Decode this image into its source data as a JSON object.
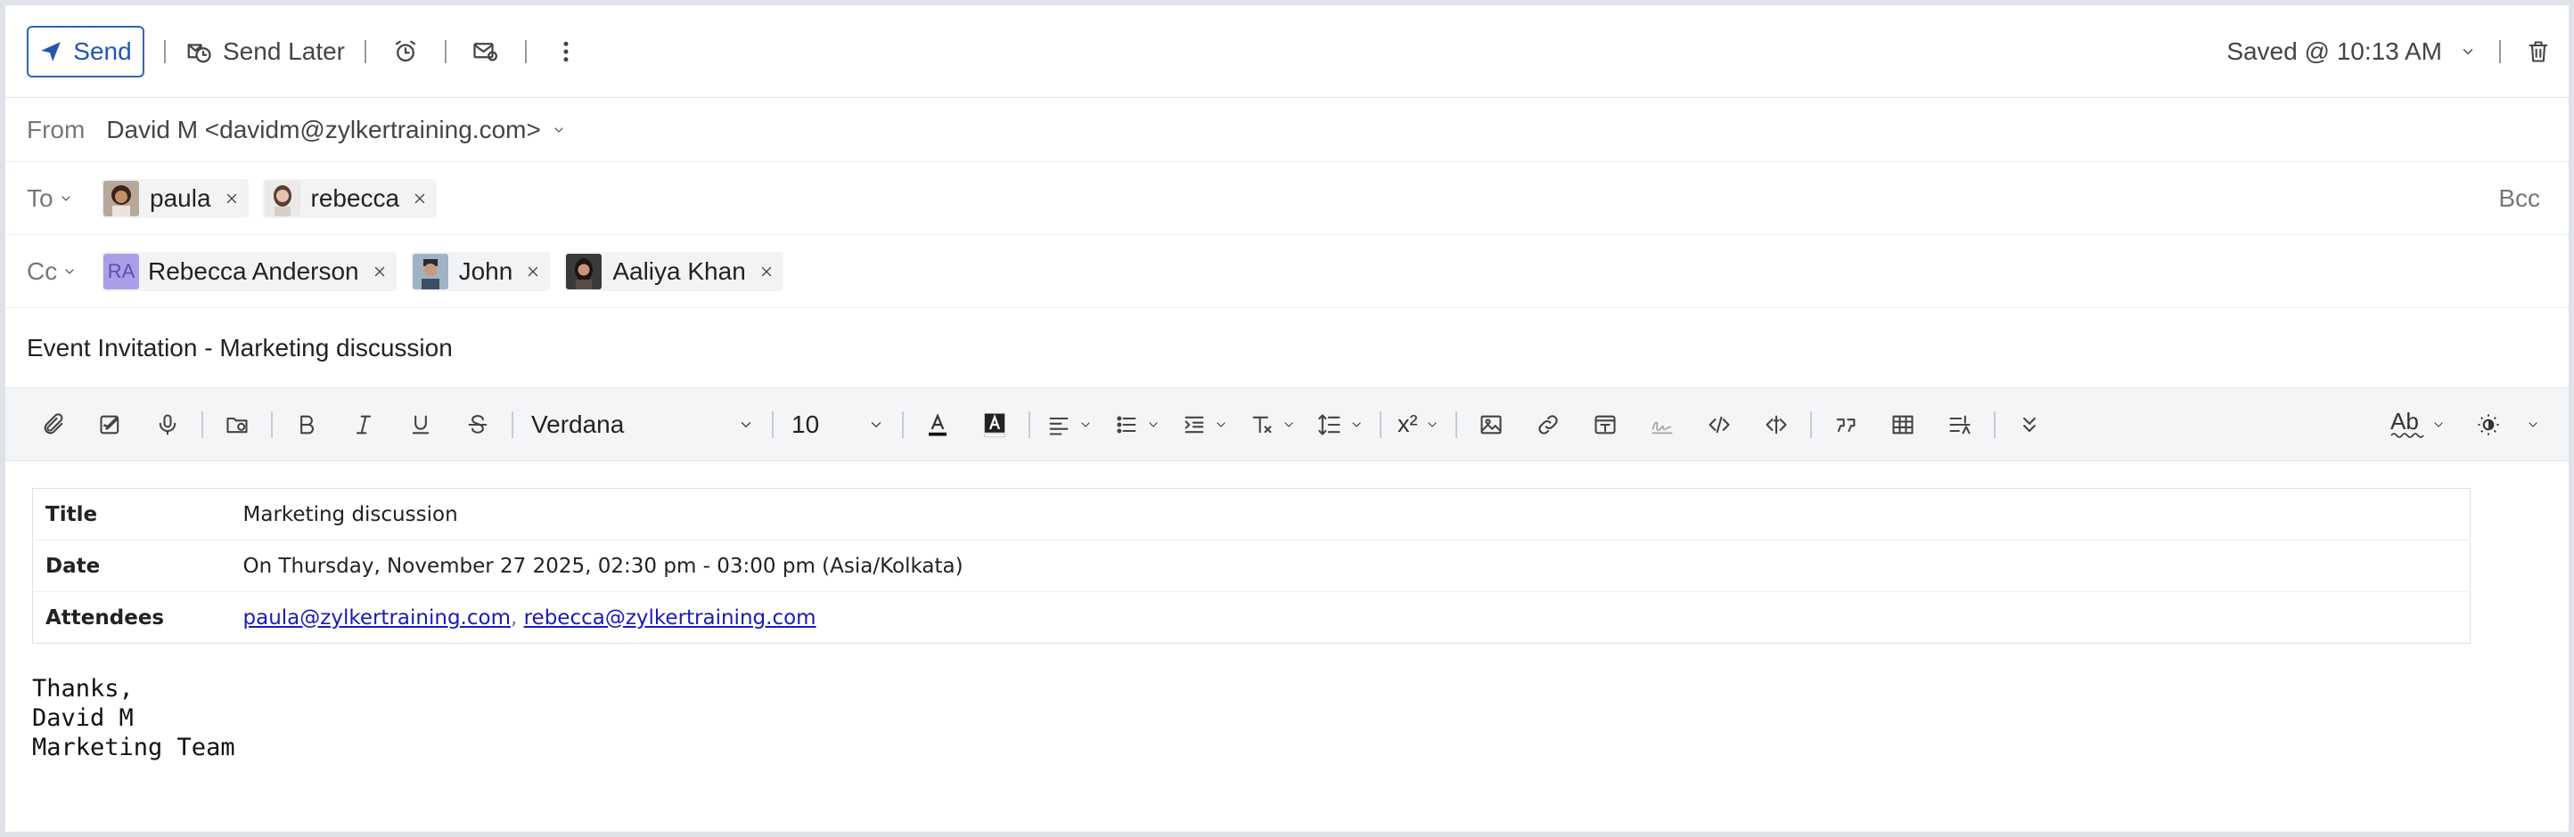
{
  "actionbar": {
    "send_label": "Send",
    "send_later_label": "Send Later",
    "saved_text": "Saved @ 10:13 AM"
  },
  "header": {
    "from_label": "From",
    "from_value": "David M <davidm@zylkertraining.com>",
    "to_label": "To",
    "cc_label": "Cc",
    "bcc_label": "Bcc",
    "to_recipients": [
      {
        "name": "paula"
      },
      {
        "name": "rebecca"
      }
    ],
    "cc_recipients": [
      {
        "name": "Rebecca Anderson",
        "initials": "RA"
      },
      {
        "name": "John"
      },
      {
        "name": "Aaliya Khan"
      }
    ],
    "subject": "Event Invitation - Marketing discussion"
  },
  "toolbar": {
    "font_family": "Verdana",
    "font_size": "10",
    "superscript_glyph": "x²",
    "spell_glyph": "Ab"
  },
  "event": {
    "rows": [
      {
        "key": "Title",
        "value": "Marketing discussion"
      },
      {
        "key": "Date",
        "value": "On Thursday, November 27 2025, 02:30 pm - 03:00 pm (Asia/Kolkata)"
      },
      {
        "key": "Attendees",
        "value": ""
      }
    ],
    "attendees": [
      "paula@zylkertraining.com",
      "rebecca@zylkertraining.com"
    ],
    "attendee_separator": ", "
  },
  "signature": [
    "Thanks,",
    "David M",
    "Marketing Team"
  ],
  "colors": {
    "accent": "#2256b0",
    "link": "#1a1ab8",
    "initials_avatar": "#a99ee8",
    "toolbar_bg": "#f4f5f6"
  }
}
